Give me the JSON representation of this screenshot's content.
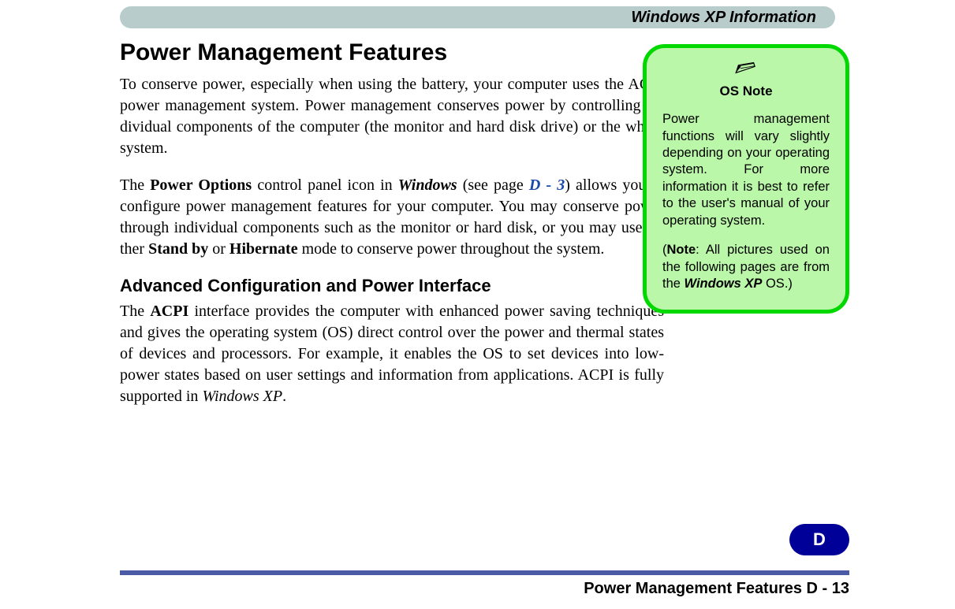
{
  "header": {
    "title": "Windows XP Information"
  },
  "main": {
    "h1": "Power Management Features",
    "p1_a": "To conserve power, especially when using the battery, your computer uses the ACPI power management system. Power management conserves power by controlling in­dividual components of the computer (the monitor and hard disk drive) or the whole system.",
    "p2_a": "The ",
    "p2_b": "Power Options",
    "p2_c": " control panel icon in ",
    "p2_d": "Windows",
    "p2_e": " (see page ",
    "p2_f": "D - 3",
    "p2_g": ") allows you to configure power management features for your computer. You may conserve power through individual components such as the monitor or hard disk, or you may use ei­ther ",
    "p2_h": "Stand by",
    "p2_i": " or ",
    "p2_j": "Hibernate",
    "p2_k": " mode to conserve power throughout the system.",
    "h2": "Advanced Configuration and Power Interface",
    "p3_a": "The ",
    "p3_b": "ACPI",
    "p3_c": " interface provides the computer with enhanced power saving techniques and gives the operating system (OS) direct control over the power and thermal states of devices and processors. For example, it enables the OS to set devices into low-power states based on user settings and information from applications. ACPI is fully supported in ",
    "p3_d": "Windows XP",
    "p3_e": "."
  },
  "note": {
    "title": "OS Note",
    "body1": "Power management functions will vary slightly depending on your operating system. For more information it is best to refer to the user's manual of your operating system.",
    "body2_a": "(",
    "body2_b": "Note",
    "body2_c": ": All pictures used on the following pages are from the ",
    "body2_d": "Windows XP",
    "body2_e": " OS.)"
  },
  "sidetab": "D",
  "footer": "Power Management Features  D  -  13"
}
